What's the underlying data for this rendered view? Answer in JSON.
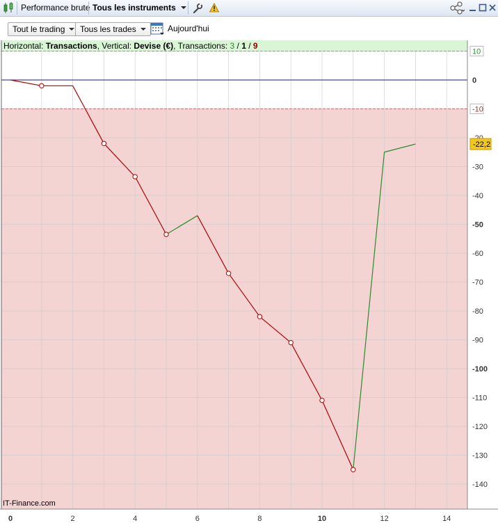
{
  "toolbar": {
    "tab_title": "Performance brute",
    "instruments_label": "Tous les instruments",
    "icon_chart": "candlestick-icon",
    "icon_settings": "wrench-icon",
    "icon_warning": "warning-icon",
    "icon_share": "share-icon"
  },
  "filters": {
    "trading": "Tout le trading",
    "trades": "Tous les trades",
    "date_label": "Aujourd'hui"
  },
  "info": {
    "h_prefix": "Horizontal: ",
    "h_value": "Transactions",
    "v_prefix": ", Vertical: ",
    "v_value": "Devise (€)",
    "t_prefix": ", Transactions: ",
    "t_win": "3",
    "slash1": " / ",
    "t_neutral": "1",
    "slash2": " / ",
    "t_loss": "9",
    "colors": {
      "win": "#2a8a2a",
      "neutral": "#000000",
      "loss": "#a00000"
    }
  },
  "watermark": "IT-Finance.com",
  "chart_data": {
    "type": "line",
    "x": [
      0,
      1,
      2,
      3,
      4,
      5,
      6,
      7,
      8,
      9,
      10,
      11,
      12,
      13
    ],
    "y": [
      0,
      -2,
      -2,
      -22,
      -33.5,
      -53.5,
      -47,
      -67,
      -82,
      -91,
      -111,
      -135,
      -25,
      -22.2
    ],
    "markers_at": [
      1,
      3,
      4,
      5,
      7,
      8,
      9,
      10,
      11
    ],
    "segment_colors": [
      "#b00000",
      "#b00000",
      "#b00000",
      "#b00000",
      "#b00000",
      "#2a8a2a",
      "#b00000",
      "#b00000",
      "#b00000",
      "#b00000",
      "#b00000",
      "#2a8a2a",
      "#2a8a2a"
    ],
    "xlim": [
      0,
      14.6
    ],
    "ylim": [
      -145,
      17
    ],
    "x_ticks": [
      "0",
      "2",
      "4",
      "6",
      "8",
      "10",
      "12",
      "14"
    ],
    "x_bold_ticks": [
      "0",
      "10"
    ],
    "y_ticks": [
      "10",
      "0",
      "-10",
      "-20",
      "-30",
      "-40",
      "-50",
      "-60",
      "-70",
      "-80",
      "-90",
      "-100",
      "-110",
      "-120",
      "-130",
      "-140"
    ],
    "y_bold_ticks": [
      "0",
      "-50",
      "-100"
    ],
    "profit_zone_above": 10,
    "loss_zone_below": -10,
    "current_value": "-22,2",
    "colors": {
      "loss_zone": "#f4d3d3",
      "profit_zone": "#d9f5d6",
      "up": "#2a8a2a",
      "down": "#b00000",
      "zero_line": "#1a1a6e",
      "current_tag": "#f3c81e"
    }
  }
}
